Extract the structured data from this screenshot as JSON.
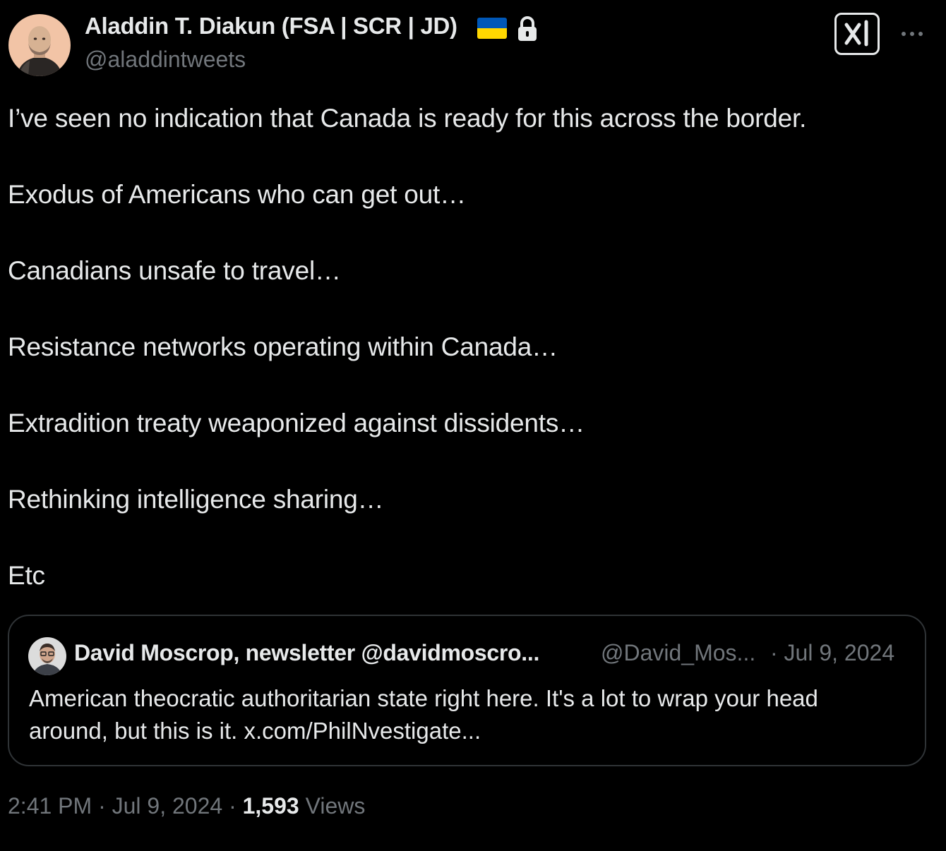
{
  "author": {
    "name": "Aladdin T. Diakun (FSA | SCR | JD)",
    "handle": "@aladdintweets",
    "flag_icon": "ukraine-flag-icon",
    "lock_icon": "lock-icon"
  },
  "header_actions": {
    "grok_icon": "grok-icon",
    "more_icon": "more-horizontal-icon"
  },
  "tweet": {
    "lines": [
      "I’ve seen no indication that Canada is ready for this across the border.",
      "Exodus of Americans who can get out…",
      "Canadians unsafe to travel…",
      "Resistance networks operating within Canada…",
      "Extradition treaty weaponized against dissidents…",
      "Rethinking intelligence sharing…",
      "Etc"
    ]
  },
  "quote": {
    "name": "David Moscrop, newsletter @davidmoscro...",
    "handle": "@David_Mos...",
    "date": "· Jul 9, 2024",
    "text_lines": [
      "American theocratic authoritarian state right here. It's a lot to wrap your head",
      "around, but this is it. x.com/PhilNvestigate..."
    ]
  },
  "meta": {
    "time": "2:41 PM",
    "separator": "·",
    "date": "Jul 9, 2024",
    "views_count": "1,593",
    "views_label": "Views"
  },
  "colors": {
    "background": "#000000",
    "text_primary": "#e7e9ea",
    "text_secondary": "#71767b",
    "border": "#2f3336",
    "flag_blue": "#0057b7",
    "flag_yellow": "#ffd700"
  }
}
